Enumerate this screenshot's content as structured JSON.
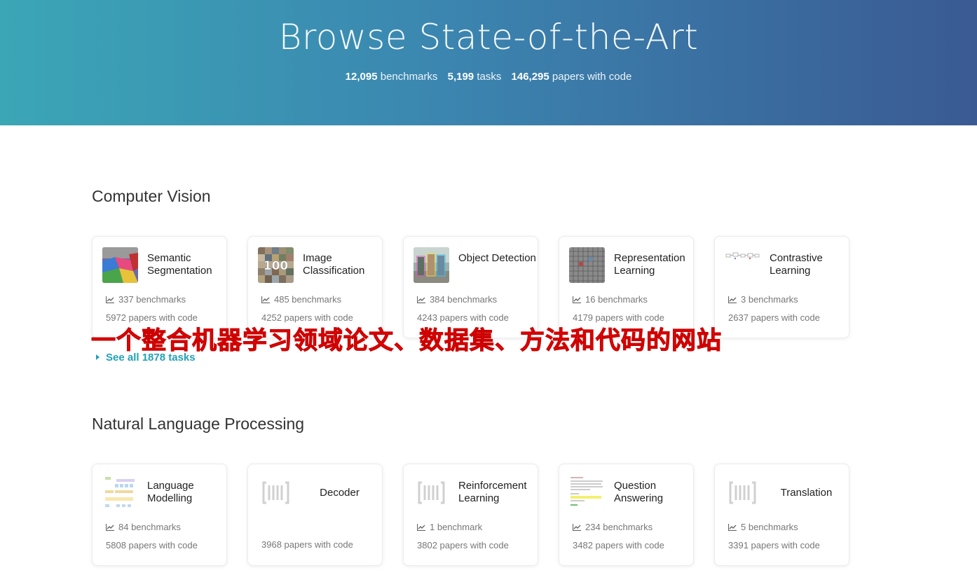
{
  "hero": {
    "title": "Browse State-of-the-Art",
    "stats": [
      {
        "value": "12,095",
        "label": "benchmarks"
      },
      {
        "value": "5,199",
        "label": "tasks"
      },
      {
        "value": "146,295",
        "label": "papers with code"
      }
    ]
  },
  "sections": [
    {
      "title": "Computer Vision",
      "see_all": "See all 1878 tasks",
      "cards": [
        {
          "name": "Semantic Segmentation",
          "benchmarks": "337 benchmarks",
          "papers": "5972 papers with code",
          "thumb": "segmentation-thumbnail"
        },
        {
          "name": "Image Classification",
          "benchmarks": "485 benchmarks",
          "papers": "4252 papers with code",
          "thumb": "image-grid-thumbnail"
        },
        {
          "name": "Object Detection",
          "benchmarks": "384 benchmarks",
          "papers": "4243 papers with code",
          "thumb": "street-scene-thumbnail"
        },
        {
          "name": "Representation Learning",
          "benchmarks": "16 benchmarks",
          "papers": "4179 papers with code",
          "thumb": "grid-thumbnail"
        },
        {
          "name": "Contrastive Learning",
          "benchmarks": "3 benchmarks",
          "papers": "2637 papers with code",
          "thumb": "diagram-thumbnail"
        }
      ]
    },
    {
      "title": "Natural Language Processing",
      "cards": [
        {
          "name": "Language Modelling",
          "benchmarks": "84 benchmarks",
          "papers": "5808 papers with code",
          "thumb": "architecture-thumbnail"
        },
        {
          "name": "Decoder",
          "benchmarks": "",
          "papers": "3968 papers with code",
          "thumb": "placeholder-bracket-icon"
        },
        {
          "name": "Reinforcement Learning",
          "benchmarks": "1 benchmark",
          "papers": "3802 papers with code",
          "thumb": "placeholder-bracket-icon"
        },
        {
          "name": "Question Answering",
          "benchmarks": "234 benchmarks",
          "papers": "3482 papers with code",
          "thumb": "text-passage-thumbnail"
        },
        {
          "name": "Translation",
          "benchmarks": "5 benchmarks",
          "papers": "3391 papers with code",
          "thumb": "placeholder-bracket-icon"
        }
      ]
    }
  ],
  "overlay_caption": "一个整合机器学习领域论文、数据集、方法和代码的网站",
  "colors": {
    "accent": "#21a2b6",
    "caption": "#ee1111",
    "hero_start": "#3ba6b6",
    "hero_end": "#3a5a93"
  }
}
